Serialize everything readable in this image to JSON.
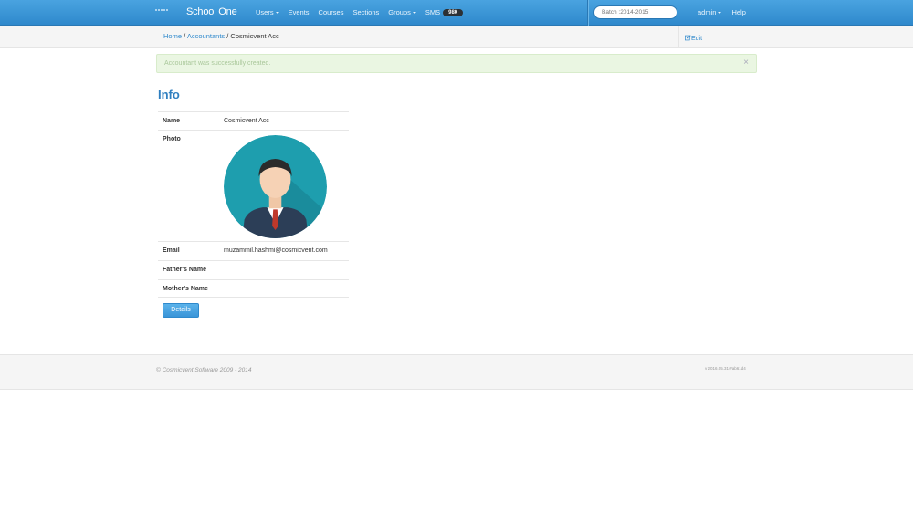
{
  "navbar": {
    "brand": "School One",
    "links": {
      "users": "Users",
      "events": "Events",
      "courses": "Courses",
      "sections": "Sections",
      "groups": "Groups",
      "sms": "SMS"
    },
    "sms_count": "980",
    "batch_placeholder": "Batch :2014-2015",
    "user": "admin",
    "help": "Help"
  },
  "breadcrumb": {
    "home": "Home",
    "accountants": "Accountants",
    "current": "Cosmicvent Acc"
  },
  "edit_label": "Edit",
  "alert": {
    "message": "Accountant was successfully created.",
    "close": "×"
  },
  "info": {
    "title": "Info",
    "name_label": "Name",
    "name_value": "Cosmicvent Acc",
    "photo_label": "Photo",
    "email_label": "Email",
    "email_value": "muzammil.hashmi@cosmicvent.com",
    "father_label": "Father's Name",
    "father_value": "",
    "mother_label": "Mother's Name",
    "mother_value": ""
  },
  "details_button": "Details",
  "footer": {
    "copyright": "© Cosmicvent Software 2009 - 2014",
    "version": "v 2016.05.31 #ab61d4"
  }
}
